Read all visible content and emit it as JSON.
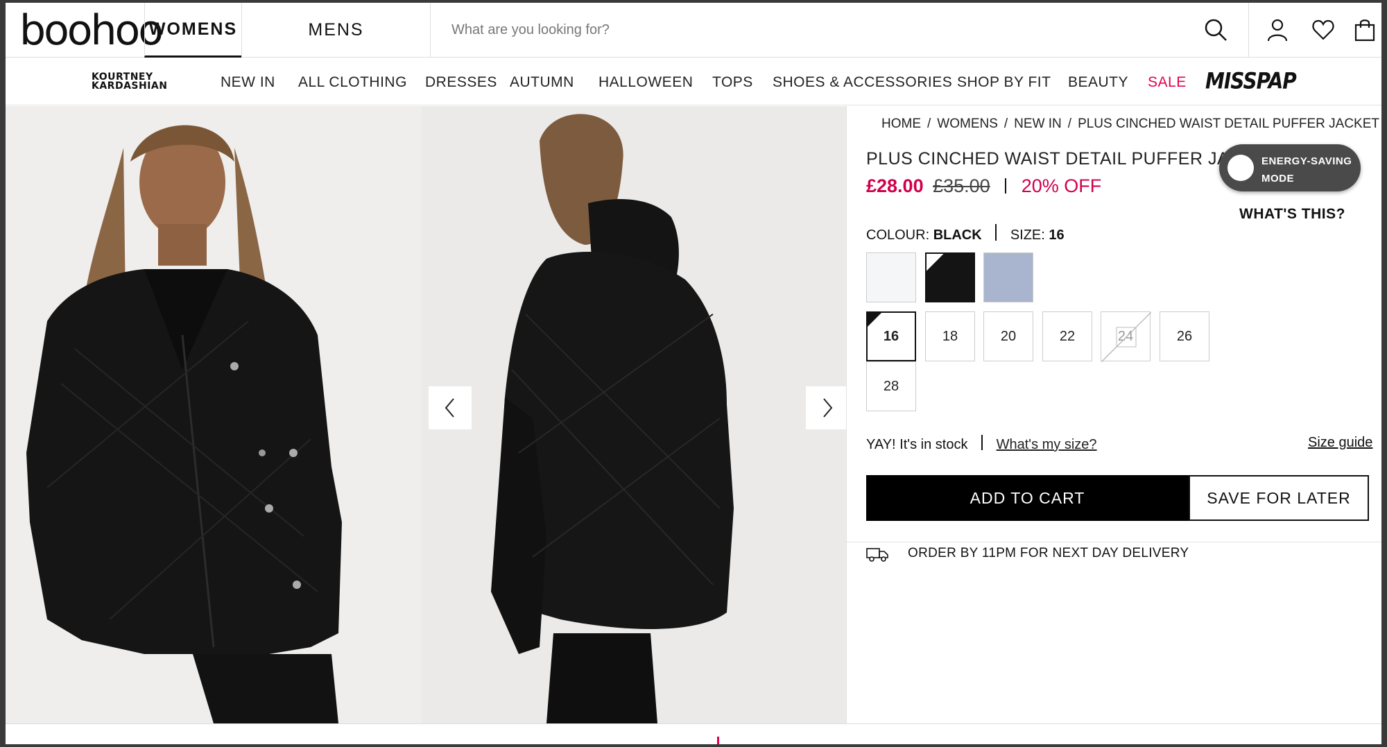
{
  "header": {
    "logo": "boohoo",
    "tabs": [
      "WOMENS",
      "MENS"
    ],
    "search_placeholder": "What are you looking for?"
  },
  "nav": {
    "brand_kk_line1": "KOURTNEY",
    "brand_kk_line2": "KARDASHIAN",
    "items": [
      "NEW IN",
      "ALL CLOTHING",
      "DRESSES",
      "AUTUMN",
      "HALLOWEEN",
      "TOPS",
      "SHOES & ACCESSORIES",
      "SHOP BY FIT",
      "BEAUTY",
      "SALE"
    ],
    "brand_misspap": "MISSPAP"
  },
  "breadcrumb": [
    "HOME",
    "WOMENS",
    "NEW IN",
    "PLUS CINCHED WAIST DETAIL PUFFER JACKET"
  ],
  "product": {
    "title": "PLUS CINCHED WAIST DETAIL PUFFER JACKET",
    "price": "£28.00",
    "was_price": "£35.00",
    "discount": "20% OFF",
    "colour_label": "COLOUR:",
    "colour_value": "BLACK",
    "size_label": "SIZE:",
    "size_value": "16",
    "swatches": [
      {
        "name": "White",
        "color": "#f4f6f8"
      },
      {
        "name": "Black",
        "color": "#141414"
      },
      {
        "name": "Blue",
        "color": "#a9b5cf"
      }
    ],
    "sizes": [
      "16",
      "18",
      "20",
      "22",
      "24",
      "26",
      "28"
    ],
    "stock_text": "YAY! It's in stock",
    "whats_my_size": "What's my size?",
    "size_guide": "Size guide",
    "add_to_cart": "ADD TO CART",
    "save_for_later": "SAVE FOR LATER",
    "delivery": "ORDER BY 11PM FOR NEXT DAY DELIVERY"
  },
  "energy_widget": {
    "line1": "ENERGY-SAVING",
    "line2": "MODE",
    "whats_this": "WHAT'S THIS?"
  },
  "colors": {
    "sale": "#e5004d",
    "price": "#d0004a"
  }
}
